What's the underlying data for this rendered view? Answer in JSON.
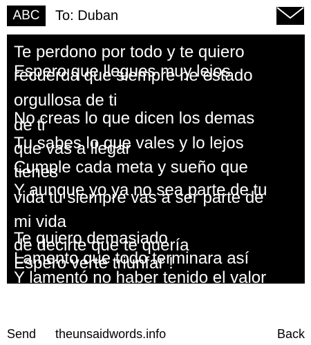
{
  "header": {
    "input_mode": "ABC",
    "recipient": "To: Duban",
    "message_icon": "envelope-icon"
  },
  "message": {
    "layer_one": [
      "Te perdono por todo y te quiero",
      "recuerda que siempre he estado",
      "orgullosa de ti",
      "No creas lo que dicen los demas",
      "Tu sabes lo que vales y lo lejos",
      "que vas a llegar",
      "Cumple cada meta y sueño que",
      "tienes",
      "Y aunque yo ya no sea parte de tu",
      "vida tu siempre vas a ser parte de",
      "mi vida",
      "Te quiero demasiado",
      "Lamento que todo terminara así",
      "Y lamentó no haber tenido el valor"
    ],
    "layer_two": [
      "Espero que llegues muy lejos",
      "de ti",
      "de decirte que te quería",
      "Espero verte triunfar !"
    ]
  },
  "footer": {
    "left_softkey": "Send",
    "center_text": "theunsaidwords.info",
    "right_softkey": "Back"
  },
  "colors": {
    "screen_background": "#ffffff",
    "message_background": "#000000",
    "message_text": "#ffffff",
    "chrome_text": "#000000"
  }
}
